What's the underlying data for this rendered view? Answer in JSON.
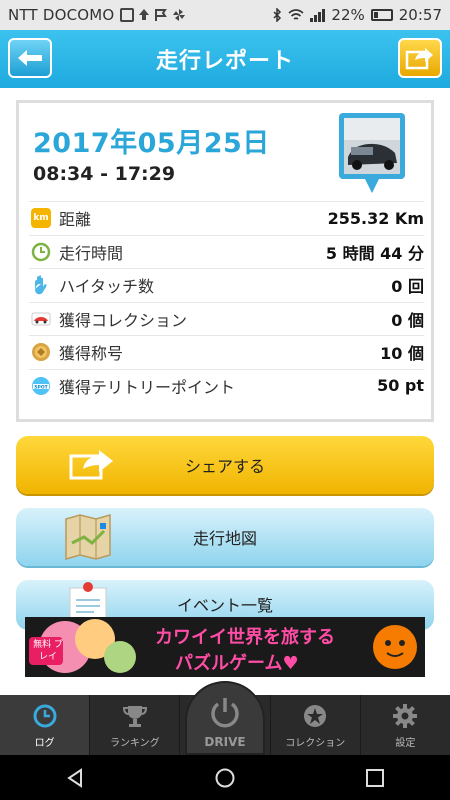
{
  "status_bar": {
    "carrier": "NTT DOCOMO",
    "battery": "22%",
    "time": "20:57"
  },
  "header": {
    "title": "走行レポート",
    "back_icon": "back-arrow-icon",
    "share_icon": "share-icon"
  },
  "report": {
    "date": "2017年05月25日",
    "time_range": "08:34 - 17:29",
    "rows": [
      {
        "icon": "km-icon",
        "label": "距離",
        "value": "255.32 Km"
      },
      {
        "icon": "clock-icon",
        "label": "走行時間",
        "value": "5 時間 44 分"
      },
      {
        "icon": "hightouch-icon",
        "label": "ハイタッチ数",
        "value": "0 回"
      },
      {
        "icon": "car-icon",
        "label": "獲得コレクション",
        "value": "0 個"
      },
      {
        "icon": "title-badge-icon",
        "label": "獲得称号",
        "value": "10 個"
      },
      {
        "icon": "spot-icon",
        "label": "獲得テリトリーポイント",
        "value": "50 pt"
      }
    ]
  },
  "buttons": {
    "share": "シェアする",
    "map": "走行地図",
    "events": "イベント一覧"
  },
  "ad": {
    "line1": "カワイイ世界を旅する",
    "line2": "パズルゲーム♥",
    "badge": "無料 プレイ"
  },
  "tabs": [
    {
      "label": "ログ",
      "icon": "clock-icon"
    },
    {
      "label": "ランキング",
      "icon": "trophy-icon"
    },
    {
      "label": "DRIVE",
      "icon": "power-icon"
    },
    {
      "label": "コレクション",
      "icon": "star-icon"
    },
    {
      "label": "設定",
      "icon": "gear-icon"
    }
  ],
  "colors": {
    "header": "#1eaadf",
    "date": "#2aa6d8",
    "share_button": "#f0b400",
    "map_button": "#8fd4ee"
  }
}
